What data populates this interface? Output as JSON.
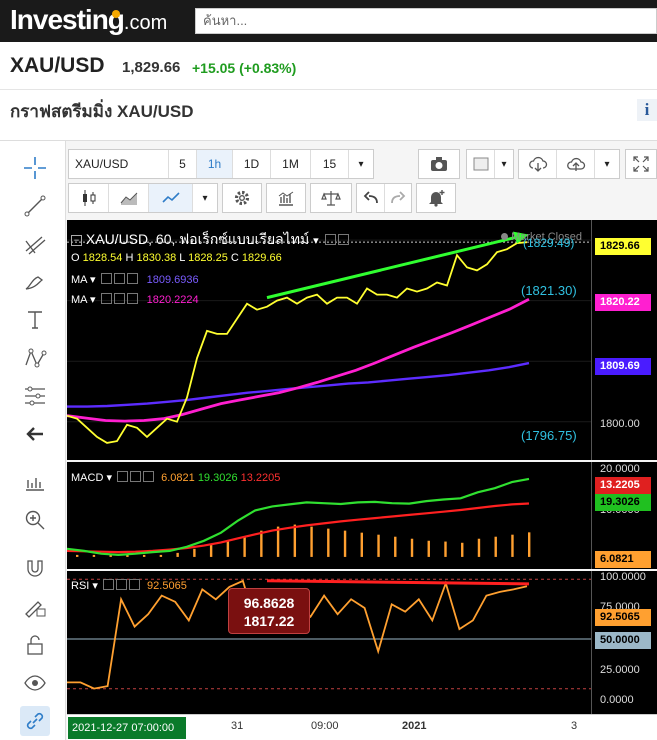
{
  "site": {
    "logo_text": "Investing",
    "logo_suffix": ".com",
    "search_placeholder": "ค้นหา..."
  },
  "quote": {
    "symbol": "XAU/USD",
    "last": "1,829.66",
    "change": "+15.05 (+0.83%)",
    "chart_title": "กราฟสตรีมมิ่ง XAU/USD",
    "info_glyph": "i"
  },
  "toolbar": {
    "symbol_field": "XAU/USD",
    "intervals": [
      "5",
      "1h",
      "1D",
      "1M",
      "15"
    ],
    "selected_interval": "1h",
    "dropdown_arrow": "▾"
  },
  "left_tools": [
    "crosshair-icon",
    "trendline-icon",
    "fib-icon",
    "brush-icon",
    "text-icon",
    "pattern-icon",
    "fib-levels-icon",
    "back-arrow-icon",
    "measure-icon",
    "zoom-icon",
    "magnet-icon",
    "lock-draw-icon",
    "unlock-icon",
    "eye-icon",
    "link-icon"
  ],
  "main_pane": {
    "title": "XAU/USD, 60, ฟอเร็กซ์แบบเรียลไทม์",
    "title_arrow": "▾",
    "market_status": "Market Closed",
    "ohlc": {
      "o_label": "O",
      "o": "1828.54",
      "h_label": "H",
      "h": "1830.38",
      "l_label": "L",
      "l": "1828.25",
      "c_label": "C",
      "c": "1829.66"
    },
    "ma1": {
      "label": "MA",
      "value": "1809.6936",
      "color": "#5c2cff"
    },
    "ma2": {
      "label": "MA",
      "value": "1820.2224",
      "color": "#ff1fd0"
    },
    "price_color": "#ffff30",
    "annotations": [
      "(1829.49)",
      "(1821.30)",
      "(1796.75)"
    ],
    "axis_tags": [
      {
        "value": "1829.66",
        "bg": "#ffff30",
        "fg": "#000"
      },
      {
        "value": "1820.22",
        "bg": "#ff1fd0",
        "fg": "#fff"
      },
      {
        "value": "1809.69",
        "bg": "#4a1cff",
        "fg": "#fff"
      }
    ],
    "axis_tick": "1800.00"
  },
  "macd_pane": {
    "label": "MACD",
    "values": [
      "6.0821",
      "19.3026",
      "13.2205"
    ],
    "colors": [
      "#ffa030",
      "#30e030",
      "#ff3030"
    ],
    "axis_ticks": [
      "20.0000",
      "10.0000"
    ],
    "axis_tags": [
      {
        "value": "13.2205",
        "bg": "#e02020",
        "fg": "#fff"
      },
      {
        "value": "19.3026",
        "bg": "#20c020",
        "fg": "#000"
      },
      {
        "value": "6.0821",
        "bg": "#ffa030",
        "fg": "#000"
      }
    ]
  },
  "rsi_pane": {
    "label": "RSI",
    "value": "92.5065",
    "color": "#ffa030",
    "axis_ticks": [
      "100.0000",
      "75.0000",
      "25.0000",
      "0.0000"
    ],
    "axis_tags": [
      {
        "value": "92.5065",
        "bg": "#ffa030",
        "fg": "#000"
      },
      {
        "value": "50.0000",
        "bg": "#9cb8c8",
        "fg": "#000"
      }
    ],
    "tooltip_line1": "96.8628",
    "tooltip_line2": "1817.22"
  },
  "time_axis": {
    "crosshair_time": "2021-12-27 07:00:00",
    "labels": [
      "31",
      "09:00",
      "2021",
      "3"
    ]
  },
  "chart_data": {
    "type": "line",
    "series": [
      {
        "name": "XAU/USD",
        "values": [
          1801,
          1800.5,
          1799,
          1797.5,
          1796.5,
          1796.8,
          1799.5,
          1799,
          1797.5,
          1799,
          1800.5,
          1800,
          1804,
          1810.5,
          1815,
          1814.5,
          1814.5,
          1817,
          1819.5,
          1818.5,
          1819,
          1820,
          1820.5,
          1819.5,
          1820.5,
          1821,
          1819.5,
          1820.5,
          1820.5,
          1819.5,
          1822,
          1821,
          1821,
          1820.5,
          1822,
          1821.5,
          1822,
          1823,
          1822.5,
          1827.5,
          1825.5,
          1825,
          1826,
          1828,
          1828.5,
          1829.5,
          1829.66
        ]
      },
      {
        "name": "MA",
        "values": [
          1802.5,
          1802.5,
          1802.6,
          1802.8,
          1803,
          1803.3,
          1803.6,
          1804,
          1804.4,
          1804.8,
          1805.1,
          1805.4,
          1805.7,
          1806,
          1806.3,
          1806.5,
          1806.8,
          1807.1,
          1807.4,
          1807.7,
          1808.1,
          1808.5,
          1809,
          1809.69
        ]
      },
      {
        "name": "MA",
        "values": [
          1801,
          1800.6,
          1800.2,
          1800.1,
          1800.2,
          1800.5,
          1801.2,
          1802.1,
          1803,
          1803.6,
          1804.2,
          1804.8,
          1805.6,
          1806.5,
          1807.5,
          1808.5,
          1809.7,
          1811,
          1812.3,
          1813.5,
          1814.7,
          1816,
          1817.3,
          1818.6,
          1820.22
        ]
      }
    ],
    "ylim": [
      1795,
      1832
    ],
    "macd": {
      "macd": [
        2,
        1.5,
        0.8,
        0.5,
        0.8,
        1.2,
        1.5,
        2.5,
        4,
        6,
        9,
        11.5,
        12.5,
        13,
        13.5,
        13.3,
        13.1,
        13.5,
        13.6,
        13.3,
        13.2,
        13.8,
        14.2,
        14.5,
        16,
        17,
        18.5,
        19.3
      ],
      "signal": [
        1.5,
        1.4,
        1.3,
        1.2,
        1.3,
        1.5,
        1.8,
        2.2,
        2.8,
        3.6,
        4.6,
        5.6,
        6.5,
        7.2,
        7.8,
        8.3,
        8.8,
        9.2,
        9.6,
        10,
        10.4,
        10.8,
        11.2,
        11.6,
        12.1,
        12.6,
        13,
        13.22
      ],
      "histogram": [
        0.5,
        0.5,
        0.5,
        0.5,
        0.5,
        0.5,
        1,
        2,
        3,
        4,
        5,
        6.5,
        7.5,
        8,
        7.5,
        7,
        6.5,
        6,
        5.5,
        5,
        4.5,
        4,
        3.8,
        3.5,
        4.5,
        5,
        5.5,
        6.08
      ],
      "ylim": [
        -2,
        22
      ]
    },
    "rsi": {
      "values": [
        15,
        15,
        10,
        12,
        82,
        60,
        70,
        85,
        80,
        65,
        90,
        82,
        92,
        96.86,
        60,
        65,
        72,
        78,
        68,
        85,
        70,
        82,
        75,
        40,
        78,
        72,
        82,
        65,
        95,
        58,
        65,
        85,
        88,
        90,
        92.5
      ],
      "ylim": [
        0,
        100
      ],
      "levels": [
        70,
        50,
        30
      ]
    }
  }
}
